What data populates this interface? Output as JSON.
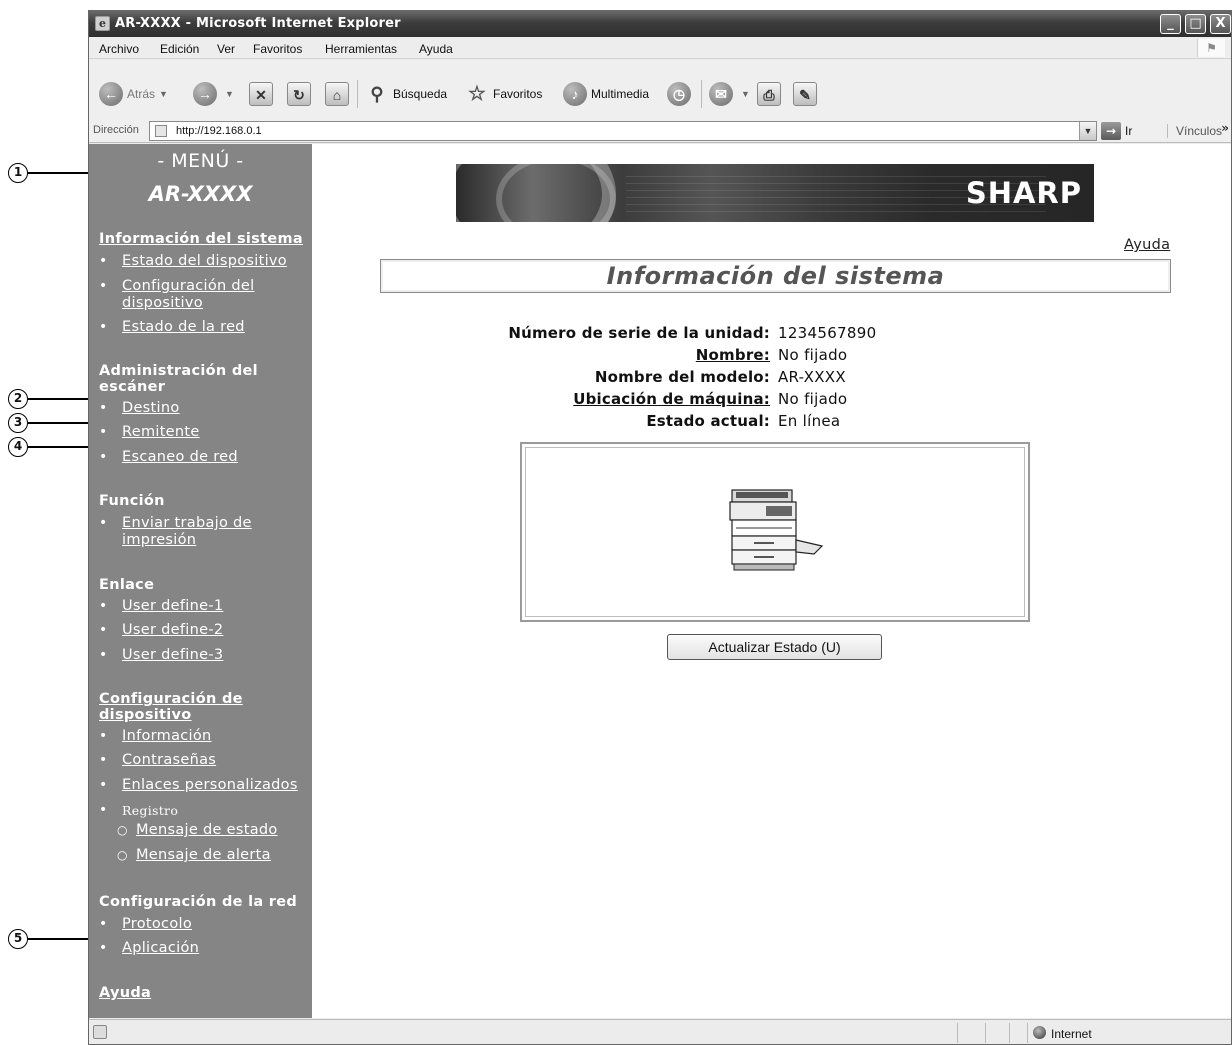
{
  "callouts": [
    "1",
    "2",
    "3",
    "4",
    "5"
  ],
  "window": {
    "title": "AR-XXXX - Microsoft Internet Explorer",
    "controls": {
      "minimize": "_",
      "maximize": "□",
      "close": "X"
    }
  },
  "menubar": [
    "Archivo",
    "Edición",
    "Ver",
    "Favoritos",
    "Herramientas",
    "Ayuda"
  ],
  "toolbar": {
    "back": "Atrás",
    "search": "Búsqueda",
    "favorites": "Favoritos",
    "multimedia": "Multimedia"
  },
  "address": {
    "label": "Dirección",
    "url": "http://192.168.0.1",
    "go": "Ir",
    "links": "Vínculos",
    "more": "»"
  },
  "sidebar": {
    "menu_title": "- MENÚ -",
    "model": "AR-XXXX",
    "sections": {
      "sys_info": "Información del sistema",
      "device_status": "Estado del dispositivo",
      "device_config": "Configuración del dispositivo",
      "network_status": "Estado de la red",
      "scanner_admin": "Administración del escáner",
      "destination": "Destino",
      "sender": "Remitente",
      "network_scan": "Escaneo de red",
      "function": "Función",
      "send_print_job": "Enviar trabajo de impresión",
      "link": "Enlace",
      "user_define_1": "User define-1",
      "user_define_2": "User define-2",
      "user_define_3": "User define-3",
      "device_settings": "Configuración de dispositivo",
      "information": "Información",
      "passwords": "Contraseñas",
      "custom_links": "Enlaces personalizados",
      "log": "Registro",
      "status_message": "Mensaje de estado",
      "alert_message": "Mensaje de alerta",
      "network_settings": "Configuración de la red",
      "protocol": "Protocolo",
      "application": "Aplicación",
      "help": "Ayuda"
    }
  },
  "main": {
    "brand": "SHARP",
    "help_link": "Ayuda",
    "heading": "Información del sistema",
    "info": [
      {
        "label": "Número de serie de la unidad:",
        "value": "1234567890"
      },
      {
        "label": "Nombre:",
        "value": "No fijado"
      },
      {
        "label": "Nombre del modelo:",
        "value": "AR-XXXX"
      },
      {
        "label": "Ubicación de máquina:",
        "value": "No fijado"
      },
      {
        "label": "Estado actual:",
        "value": "En línea"
      }
    ],
    "update_button": "Actualizar Estado (U)"
  },
  "statusbar": {
    "zone": "Internet"
  }
}
